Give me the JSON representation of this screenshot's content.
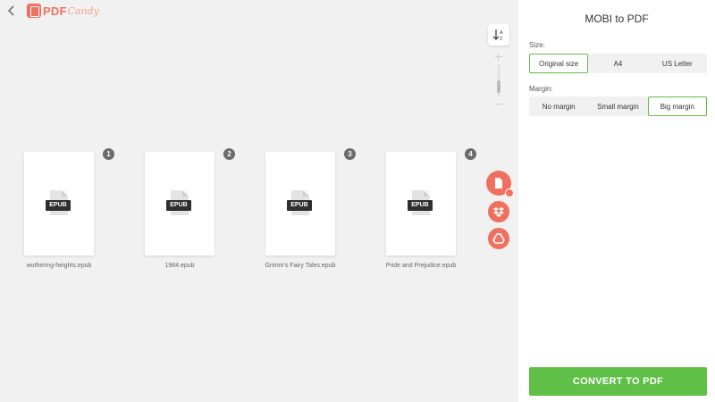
{
  "header": {
    "logo_pdf": "PDF",
    "logo_candy": "Candy"
  },
  "files": [
    {
      "index": "1",
      "name": "wuthering-heights.epub",
      "type": "EPUB"
    },
    {
      "index": "2",
      "name": "1984.epub",
      "type": "EPUB"
    },
    {
      "index": "3",
      "name": "Grimm's Fairy Tales.epub",
      "type": "EPUB"
    },
    {
      "index": "4",
      "name": "Pride and Prejudice.epub",
      "type": "EPUB"
    }
  ],
  "colors": {
    "brand": "#f07060",
    "accent": "#5fbf47"
  },
  "panel": {
    "title": "MOBI to PDF",
    "size_label": "Size:",
    "size_options": [
      "Original size",
      "A4",
      "US Letter"
    ],
    "size_selected": "Original size",
    "margin_label": "Margin:",
    "margin_options": [
      "No margin",
      "Small margin",
      "Big margin"
    ],
    "margin_selected": "Big margin",
    "convert_label": "CONVERT TO PDF"
  }
}
